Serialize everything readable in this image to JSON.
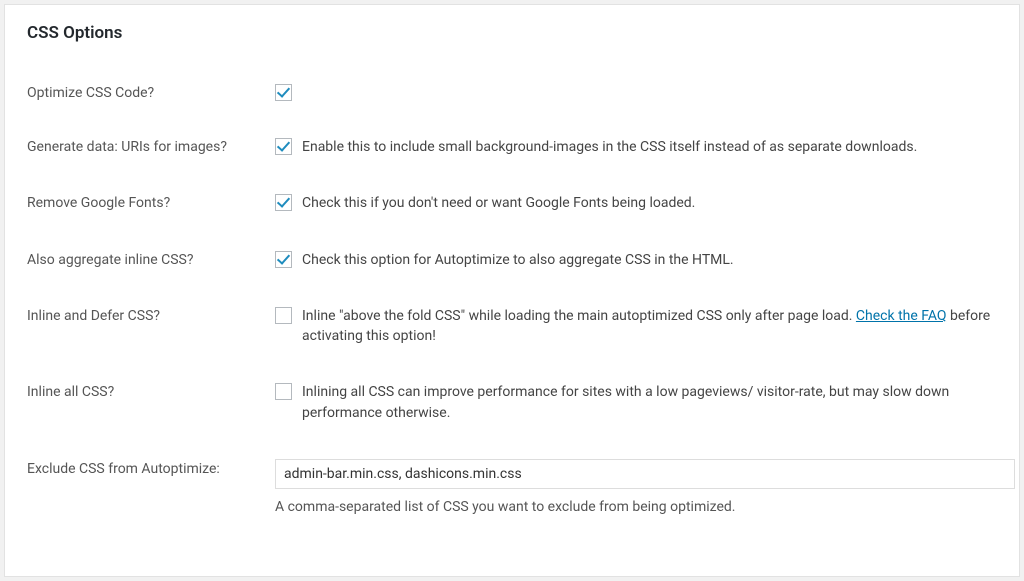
{
  "section_title": "CSS Options",
  "rows": {
    "optimize": {
      "label": "Optimize CSS Code?",
      "checked": true,
      "desc": ""
    },
    "datauri": {
      "label": "Generate data: URIs for images?",
      "checked": true,
      "desc": "Enable this to include small background-images in the CSS itself instead of as separate downloads."
    },
    "gfonts": {
      "label": "Remove Google Fonts?",
      "checked": true,
      "desc": "Check this if you don't need or want Google Fonts being loaded."
    },
    "agg_inline": {
      "label": "Also aggregate inline CSS?",
      "checked": true,
      "desc": "Check this option for Autoptimize to also aggregate CSS in the HTML."
    },
    "inline_defer": {
      "label": "Inline and Defer CSS?",
      "checked": false,
      "desc_pre": "Inline \"above the fold CSS\" while loading the main autoptimized CSS only after page load. ",
      "link_text": "Check the FAQ",
      "desc_post": " before activating this option!"
    },
    "inline_all": {
      "label": "Inline all CSS?",
      "checked": false,
      "desc": "Inlining all CSS can improve performance for sites with a low pageviews/ visitor-rate, but may slow down performance otherwise."
    },
    "exclude": {
      "label": "Exclude CSS from Autoptimize:",
      "value": "admin-bar.min.css, dashicons.min.css",
      "help": "A comma-separated list of CSS you want to exclude from being optimized."
    }
  }
}
